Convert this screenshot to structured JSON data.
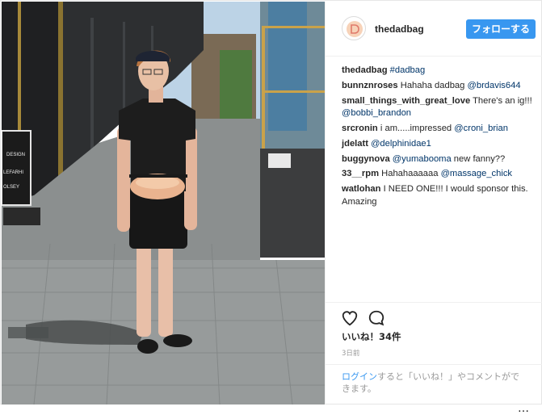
{
  "post": {
    "username": "thedadbag",
    "follow_label": "フォローする",
    "more_label": "…"
  },
  "comments": [
    {
      "user": "thedadbag",
      "text": "",
      "link": "#dadbag"
    },
    {
      "user": "bunnznroses",
      "text": "Hahaha dadbag ",
      "link": "@brdavis644"
    },
    {
      "user": "small_things_with_great_love",
      "text": "There's an ig!!! ",
      "link": "@bobbi_brandon"
    },
    {
      "user": "srcronin",
      "text": "i am.....impressed ",
      "link": "@croni_brian"
    },
    {
      "user": "jdelatt",
      "text": "",
      "link": "@delphinidae1"
    },
    {
      "user": "buggynova",
      "text": "",
      "link": "@yumabooma",
      "after": " new fanny??"
    },
    {
      "user": "33__rpm",
      "text": "Hahahaaaaaa ",
      "link": "@massage_chick"
    },
    {
      "user": "watlohan",
      "text": "I NEED ONE!!! I would sponsor this. Amazing",
      "link": ""
    }
  ],
  "actions": {
    "likes": "いいね！34件",
    "time_ago": "3日前",
    "login_link": "ログイン",
    "login_rest": "すると「いいね！」やコメントができます。"
  },
  "photo": {
    "sign_lines": [
      "DESIGN",
      "LEFARHI",
      "OLSEY"
    ]
  },
  "colors": {
    "accent": "#3897f0",
    "link": "#003569",
    "muted": "#999999"
  }
}
